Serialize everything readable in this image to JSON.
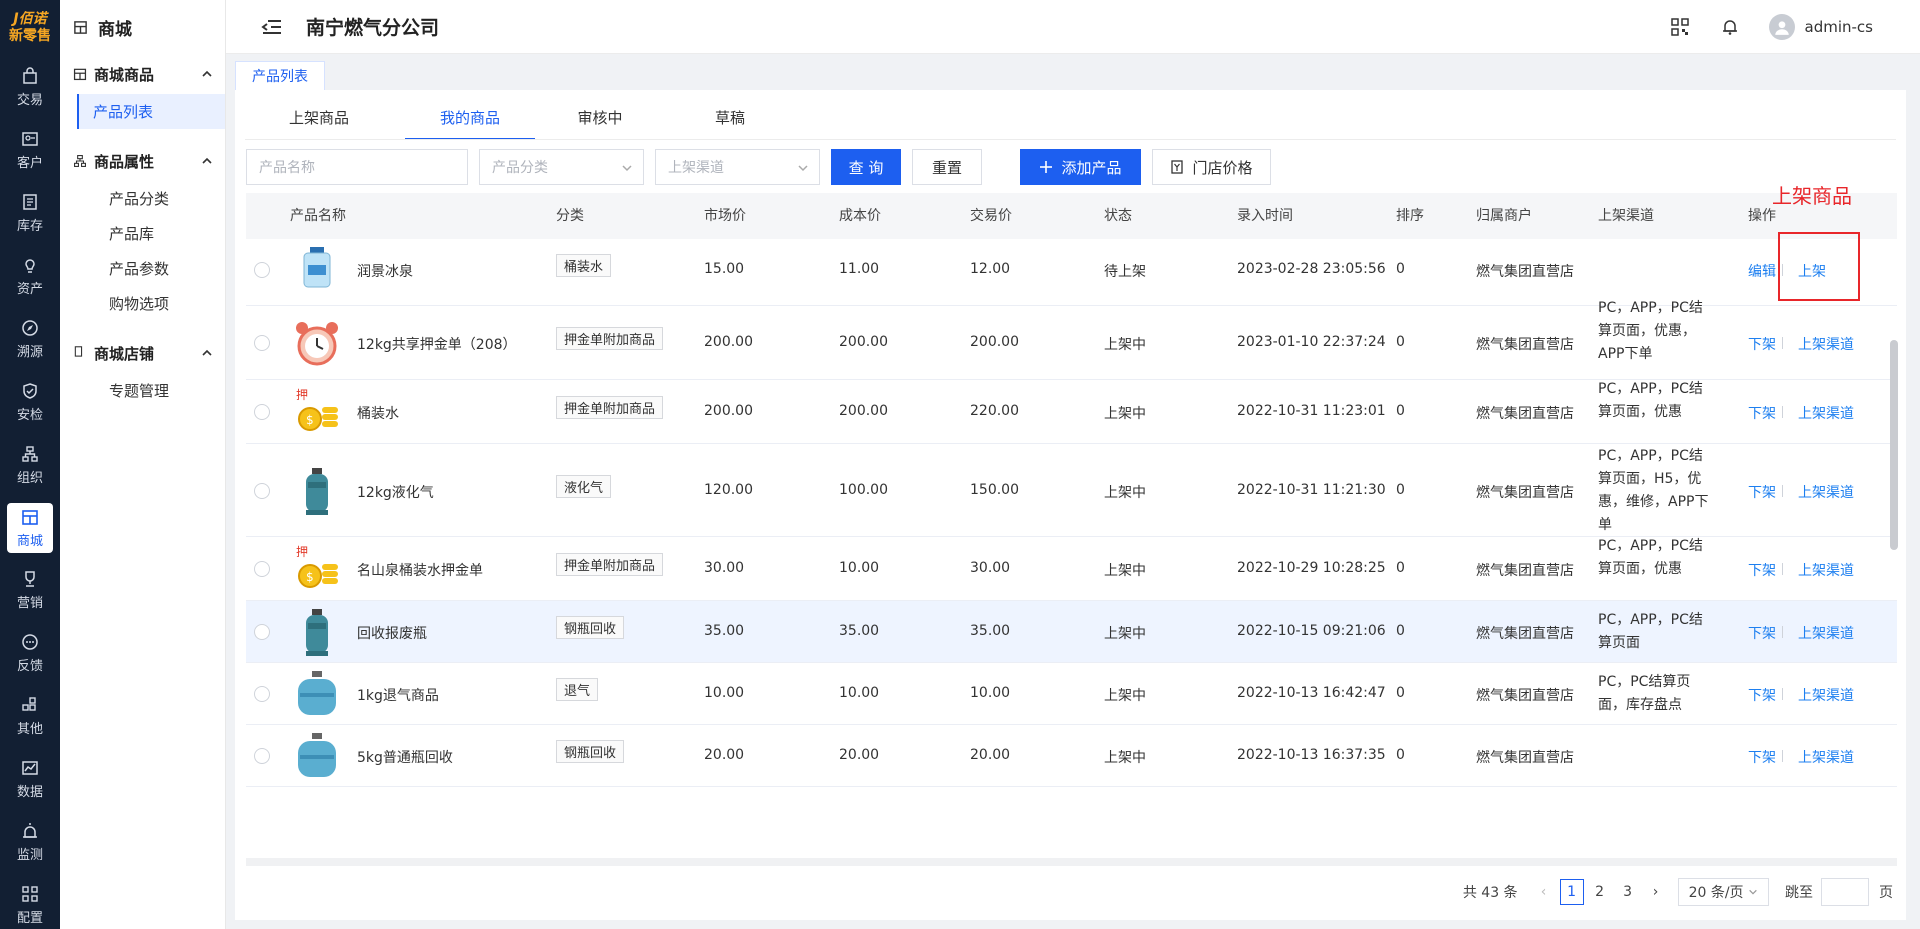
{
  "logo": {
    "line1": "J佰诺",
    "line2": "新零售"
  },
  "rail": [
    {
      "label": "交易",
      "icon": "bag-icon"
    },
    {
      "label": "客户",
      "icon": "id-card-icon"
    },
    {
      "label": "库存",
      "icon": "list-icon"
    },
    {
      "label": "资产",
      "icon": "bulb-icon"
    },
    {
      "label": "溯源",
      "icon": "compass-icon"
    },
    {
      "label": "安检",
      "icon": "shield-icon"
    },
    {
      "label": "组织",
      "icon": "org-icon"
    },
    {
      "label": "商城",
      "icon": "store-icon",
      "active": true
    },
    {
      "label": "营销",
      "icon": "trophy-icon"
    },
    {
      "label": "反馈",
      "icon": "chat-icon"
    },
    {
      "label": "其他",
      "icon": "apps-icon"
    },
    {
      "label": "数据",
      "icon": "chart-icon"
    },
    {
      "label": "监测",
      "icon": "alarm-icon"
    },
    {
      "label": "配置",
      "icon": "grid-icon"
    }
  ],
  "sidebar": {
    "title": "商城",
    "groups": [
      {
        "label": "商城商品",
        "items": [
          "产品列表"
        ]
      },
      {
        "label": "商品属性",
        "items": [
          "产品分类",
          "产品库",
          "产品参数",
          "购物选项"
        ]
      },
      {
        "label": "商城店铺",
        "items": [
          "专题管理"
        ]
      }
    ]
  },
  "header": {
    "title": "南宁燃气分公司",
    "username": "admin-cs"
  },
  "tagbar": {
    "tag": "产品列表"
  },
  "tabs": [
    "上架商品",
    "我的商品",
    "审核中",
    "草稿"
  ],
  "filters": {
    "name_placeholder": "产品名称",
    "category_placeholder": "产品分类",
    "channel_placeholder": "上架渠道",
    "query": "查 询",
    "reset": "重置",
    "add": "添加产品",
    "store_price": "门店价格"
  },
  "table": {
    "headers": [
      "产品名称",
      "分类",
      "市场价",
      "成本价",
      "交易价",
      "状态",
      "录入时间",
      "排序",
      "归属商户",
      "上架渠道",
      "操作"
    ],
    "rows": [
      {
        "name": "润景冰泉",
        "category": "桶装水",
        "market": "15.00",
        "cost": "11.00",
        "trade": "12.00",
        "status": "待上架",
        "time": "2023-02-28 23:05:56",
        "sort": "0",
        "merchant": "燃气集团直营店",
        "channel": "",
        "op1": "编辑",
        "op2": "上架",
        "thumb": "water-bottle"
      },
      {
        "name": "12kg共享押金单（208）",
        "category": "押金单附加商品",
        "market": "200.00",
        "cost": "200.00",
        "trade": "200.00",
        "status": "上架中",
        "time": "2023-01-10 22:37:24",
        "sort": "0",
        "merchant": "燃气集团直营店",
        "channel": "PC，APP，PC结算页面，优惠，APP下单",
        "op1": "下架",
        "op2": "上架渠道",
        "thumb": "alarm-clock"
      },
      {
        "name": "桶装水",
        "category": "押金单附加商品",
        "market": "200.00",
        "cost": "200.00",
        "trade": "220.00",
        "status": "上架中",
        "time": "2022-10-31 11:23:01",
        "sort": "0",
        "merchant": "燃气集团直营店",
        "channel": "PC，APP，PC结算页面，优惠",
        "op1": "下架",
        "op2": "上架渠道",
        "thumb": "coins"
      },
      {
        "name": "12kg液化气",
        "category": "液化气",
        "market": "120.00",
        "cost": "100.00",
        "trade": "150.00",
        "status": "上架中",
        "time": "2022-10-31 11:21:30",
        "sort": "0",
        "merchant": "燃气集团直营店",
        "channel": "PC，APP，PC结算页面，H5，优惠，维修，APP下单",
        "op1": "下架",
        "op2": "上架渠道",
        "thumb": "gas-cylinder"
      },
      {
        "name": "名山泉桶装水押金单",
        "category": "押金单附加商品",
        "market": "30.00",
        "cost": "10.00",
        "trade": "30.00",
        "status": "上架中",
        "time": "2022-10-29 10:28:25",
        "sort": "0",
        "merchant": "燃气集团直营店",
        "channel": "PC，APP，PC结算页面，优惠",
        "op1": "下架",
        "op2": "上架渠道",
        "thumb": "coins"
      },
      {
        "name": "回收报废瓶",
        "category": "钢瓶回收",
        "market": "35.00",
        "cost": "35.00",
        "trade": "35.00",
        "status": "上架中",
        "time": "2022-10-15 09:21:06",
        "sort": "0",
        "merchant": "燃气集团直营店",
        "channel": "PC，APP，PC结算页面",
        "op1": "下架",
        "op2": "上架渠道",
        "thumb": "gas-cylinder"
      },
      {
        "name": "1kg退气商品",
        "category": "退气",
        "market": "10.00",
        "cost": "10.00",
        "trade": "10.00",
        "status": "上架中",
        "time": "2022-10-13 16:42:47",
        "sort": "0",
        "merchant": "燃气集团直营店",
        "channel": "PC，PC结算页面，库存盘点",
        "op1": "下架",
        "op2": "上架渠道",
        "thumb": "small-cylinder"
      },
      {
        "name": "5kg普通瓶回收",
        "category": "钢瓶回收",
        "market": "20.00",
        "cost": "20.00",
        "trade": "20.00",
        "status": "上架中",
        "time": "2022-10-13 16:37:35",
        "sort": "0",
        "merchant": "燃气集团直营店",
        "channel": "",
        "op1": "下架",
        "op2": "上架渠道",
        "thumb": "small-cylinder"
      }
    ]
  },
  "pager": {
    "total": "共 43 条",
    "pages": [
      "1",
      "2",
      "3"
    ],
    "active": "1",
    "size": "20 条/页",
    "jump_label": "跳至",
    "page_suffix": "页"
  },
  "annotation": {
    "text": "上架商品",
    "color": "#e8262a"
  },
  "colors": {
    "primary": "#1d5ff0",
    "link": "#1d7ff0",
    "rail_bg": "#121f33",
    "logo": "#f5a623"
  }
}
